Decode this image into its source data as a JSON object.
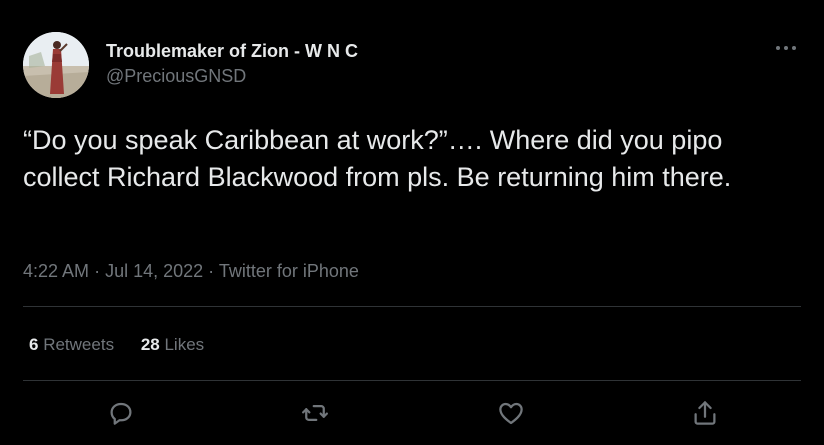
{
  "tweet": {
    "author": {
      "display_name": "Troublemaker of Zion - W N C",
      "handle": "@PreciousGNSD"
    },
    "text": "“Do you speak Caribbean at work?”…. Where did you pipo collect Richard Blackwood from pls. Be returning him there.",
    "time": "4:22 AM",
    "date": "Jul 14, 2022",
    "source": "Twitter for iPhone",
    "separator": "·",
    "stats": {
      "retweets_count": "6",
      "retweets_label": "Retweets",
      "likes_count": "28",
      "likes_label": "Likes"
    },
    "actions": [
      "reply-icon",
      "retweet-icon",
      "like-icon",
      "share-icon"
    ],
    "more_icon": "more-horizontal-icon"
  },
  "colors": {
    "background": "#000000",
    "primary_text": "#e7e9ea",
    "secondary_text": "#71767b",
    "divider": "#2f3336"
  }
}
